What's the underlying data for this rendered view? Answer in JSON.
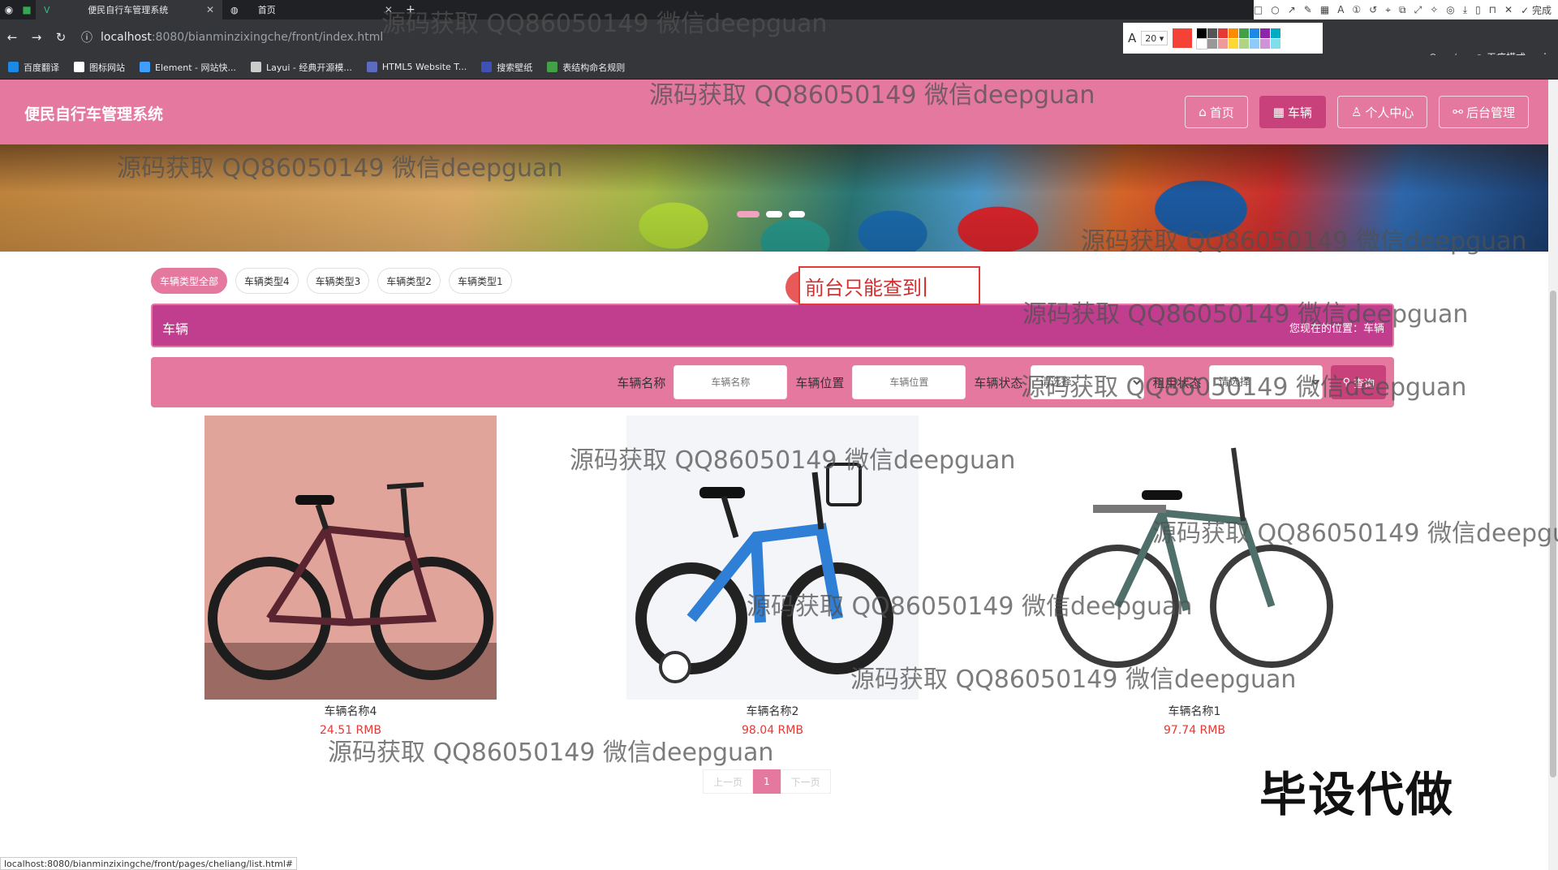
{
  "browser": {
    "tabs": [
      {
        "label": "便民自行车管理系统"
      },
      {
        "label": "首页"
      }
    ],
    "url_host": "localhost",
    "url_path": ":8080/bianminzixingche/front/index.html",
    "annot_size": "20",
    "annot_done": "完成",
    "incognito": "无痕模式",
    "bookmarks": [
      "百度翻译",
      "图标网站",
      "Element - 网站快...",
      "Layui - 经典开源模...",
      "HTML5 Website T...",
      "搜索壁纸",
      "表结构命名规则"
    ]
  },
  "header": {
    "site_title": "便民自行车管理系统",
    "nav": [
      "首页",
      "车辆",
      "个人中心",
      "后台管理"
    ]
  },
  "categories": [
    "车辆类型全部",
    "车辆类型4",
    "车辆类型3",
    "车辆类型2",
    "车辆类型1"
  ],
  "annotation_text": "前台只能查到",
  "breadcrumb": {
    "title": "车辆",
    "location": "您现在的位置：车辆"
  },
  "search": {
    "name_label": "车辆名称",
    "name_placeholder": "车辆名称",
    "location_label": "车辆位置",
    "location_placeholder": "车辆位置",
    "status_label": "车辆状态",
    "status_value": "请选择",
    "rent_label": "租用状态",
    "rent_value": "请选择",
    "button_label": "查询"
  },
  "products": [
    {
      "name": "车辆名称4",
      "price": "24.51 RMB"
    },
    {
      "name": "车辆名称2",
      "price": "98.04 RMB"
    },
    {
      "name": "车辆名称1",
      "price": "97.74 RMB"
    }
  ],
  "pager": {
    "prev": "上一页",
    "current": "1",
    "next": "下一页"
  },
  "status_url": "localhost:8080/bianminzixingche/front/pages/cheliang/list.html#",
  "watermark": "源码获取 QQ86050149 微信deepguan",
  "overlay_text": "毕设代做",
  "colors": {
    "header": "#e5789e",
    "accent": "#c9417a",
    "breadcrumb": "#c13e8e",
    "price": "#e53935"
  }
}
